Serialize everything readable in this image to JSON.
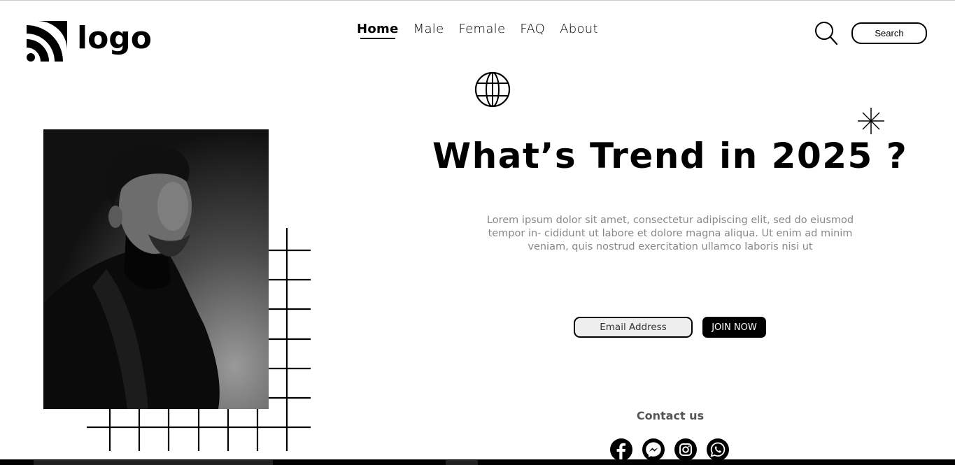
{
  "brand": {
    "logo_text": "logo"
  },
  "nav": {
    "items": [
      {
        "label": "Home",
        "active": true
      },
      {
        "label": "Male"
      },
      {
        "label": "Female"
      },
      {
        "label": "FAQ"
      },
      {
        "label": "About"
      }
    ]
  },
  "search": {
    "button_label": "Search"
  },
  "hero": {
    "headline": "What’s Trend in 2025 ?",
    "body_line1": "Lorem ipsum dolor sit amet, consectetur adipiscing elit, sed do eiusmod",
    "body_line2": "tempor in- cididunt ut labore et dolore magna aliqua. Ut enim ad minim",
    "body_line3": "veniam, quis nostrud exercitation ullamco laboris nisi ut"
  },
  "signup": {
    "email_placeholder": "Email Address",
    "join_label": "JOIN NOW"
  },
  "contact": {
    "heading": "Contact us"
  },
  "social": [
    "facebook-icon",
    "messenger-icon",
    "instagram-icon",
    "whatsapp-icon"
  ],
  "colors": {
    "accent": "#000000",
    "muted_text": "#888888",
    "input_bg": "#eeeeee"
  }
}
